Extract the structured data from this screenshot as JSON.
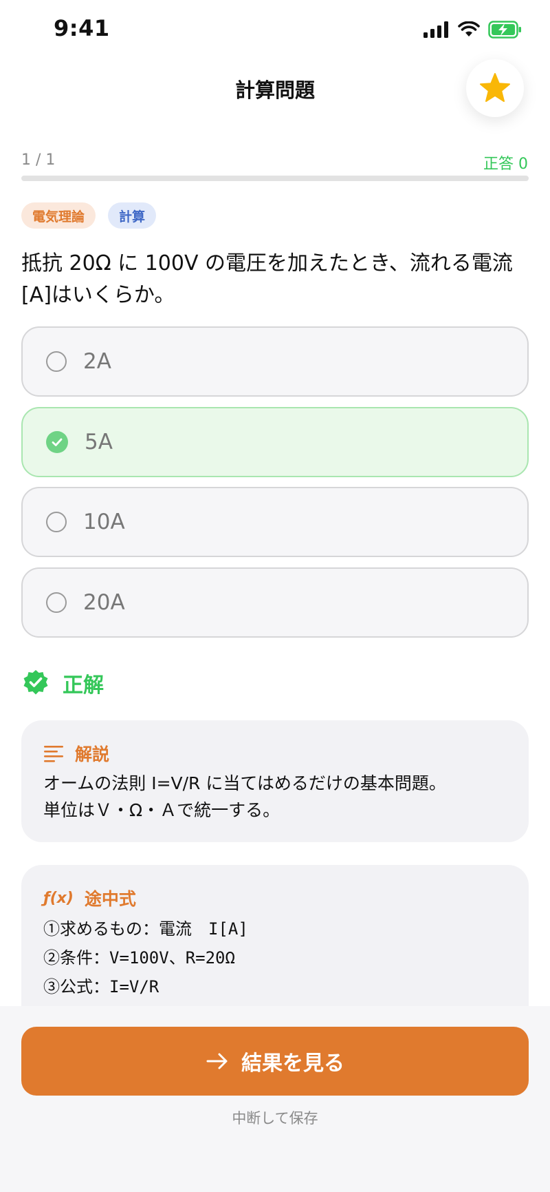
{
  "status_bar": {
    "time": "9:41"
  },
  "header": {
    "title": "計算問題",
    "star_icon": "star-icon"
  },
  "progress": {
    "label": "1 / 1",
    "correct_label": "正答 0",
    "fraction": 0.0
  },
  "tags": [
    {
      "label": "電気理論",
      "color": "#e07a2e"
    },
    {
      "label": "計算",
      "color": "#3f68c6"
    }
  ],
  "question": {
    "line1": "抵抗 20Ω に 100V の電圧を加えたとき、流れる電流",
    "line2": "[A]はいくらか。"
  },
  "options": [
    {
      "label": "2A",
      "selected": false
    },
    {
      "label": "5A",
      "selected": true
    },
    {
      "label": "10A",
      "selected": false
    },
    {
      "label": "20A",
      "selected": false
    }
  ],
  "result": {
    "label": "正解",
    "color": "#34c759"
  },
  "explanation": {
    "title": "解説",
    "line1": "オームの法則 I=V/R に当てはめるだけの基本問題。",
    "line2": "単位はＶ・Ω・Ａで統一する。"
  },
  "steps": {
    "icon_label": "ƒ(x)",
    "title": "途中式",
    "lines": [
      "①求めるもの：電流　I[A]",
      "②条件：V=100V、R=20Ω",
      "③公式：I=V/R"
    ]
  },
  "footer": {
    "cta_label": "結果を見る",
    "pause_label": "中断して保存"
  },
  "colors": {
    "accent": "#e07a2e",
    "success": "#34c759"
  }
}
